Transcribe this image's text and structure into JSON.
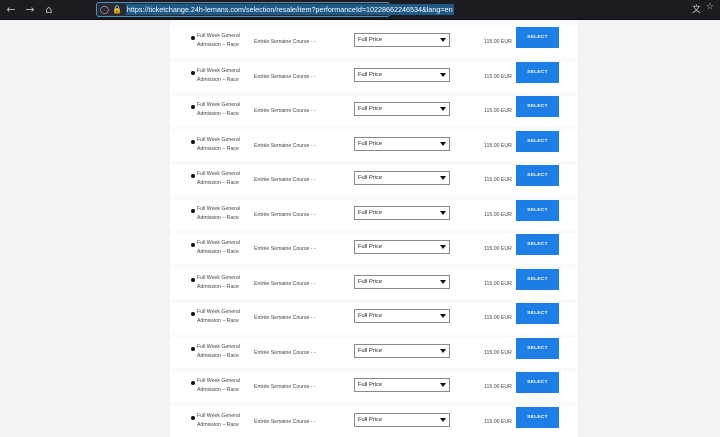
{
  "browser": {
    "url": "https://ticketchange.24h-lemans.com/selection/resale/item?performanceId=10228662246534&lang=en"
  },
  "rows": [
    {
      "name_line1": "Full Week General",
      "name_line2": "Admission – Race",
      "description": "Entrée Semaine Course - -",
      "price_type": "Full Price",
      "price": "115.00 EUR",
      "button": "SELECT"
    },
    {
      "name_line1": "Full Week General",
      "name_line2": "Admission – Race",
      "description": "Entrée Semaine Course - -",
      "price_type": "Full Price",
      "price": "115.00 EUR",
      "button": "SELECT"
    },
    {
      "name_line1": "Full Week General",
      "name_line2": "Admission – Race",
      "description": "Entrée Semaine Course - -",
      "price_type": "Full Price",
      "price": "115.00 EUR",
      "button": "SELECT"
    },
    {
      "name_line1": "Full Week General",
      "name_line2": "Admission – Race",
      "description": "Entrée Semaine Course - -",
      "price_type": "Full Price",
      "price": "115.00 EUR",
      "button": "SELECT"
    },
    {
      "name_line1": "Full Week General",
      "name_line2": "Admission – Race",
      "description": "Entrée Semaine Course - -",
      "price_type": "Full Price",
      "price": "115.00 EUR",
      "button": "SELECT"
    },
    {
      "name_line1": "Full Week General",
      "name_line2": "Admission – Race",
      "description": "Entrée Semaine Course - -",
      "price_type": "Full Price",
      "price": "115.00 EUR",
      "button": "SELECT"
    },
    {
      "name_line1": "Full Week General",
      "name_line2": "Admission – Race",
      "description": "Entrée Semaine Course - -",
      "price_type": "Full Price",
      "price": "115.00 EUR",
      "button": "SELECT"
    },
    {
      "name_line1": "Full Week General",
      "name_line2": "Admission – Race",
      "description": "Entrée Semaine Course - -",
      "price_type": "Full Price",
      "price": "115.00 EUR",
      "button": "SELECT"
    },
    {
      "name_line1": "Full Week General",
      "name_line2": "Admission – Race",
      "description": "Entrée Semaine Course - -",
      "price_type": "Full Price",
      "price": "115.00 EUR",
      "button": "SELECT"
    },
    {
      "name_line1": "Full Week General",
      "name_line2": "Admission – Race",
      "description": "Entrée Semaine Course - -",
      "price_type": "Full Price",
      "price": "115.00 EUR",
      "button": "SELECT"
    },
    {
      "name_line1": "Full Week General",
      "name_line2": "Admission – Race",
      "description": "Entrée Semaine Course - -",
      "price_type": "Full Price",
      "price": "115.00 EUR",
      "button": "SELECT"
    },
    {
      "name_line1": "Full Week General",
      "name_line2": "Admission – Race",
      "description": "Entrée Semaine Course - -",
      "price_type": "Full Price",
      "price": "115.00 EUR",
      "button": "SELECT"
    }
  ]
}
